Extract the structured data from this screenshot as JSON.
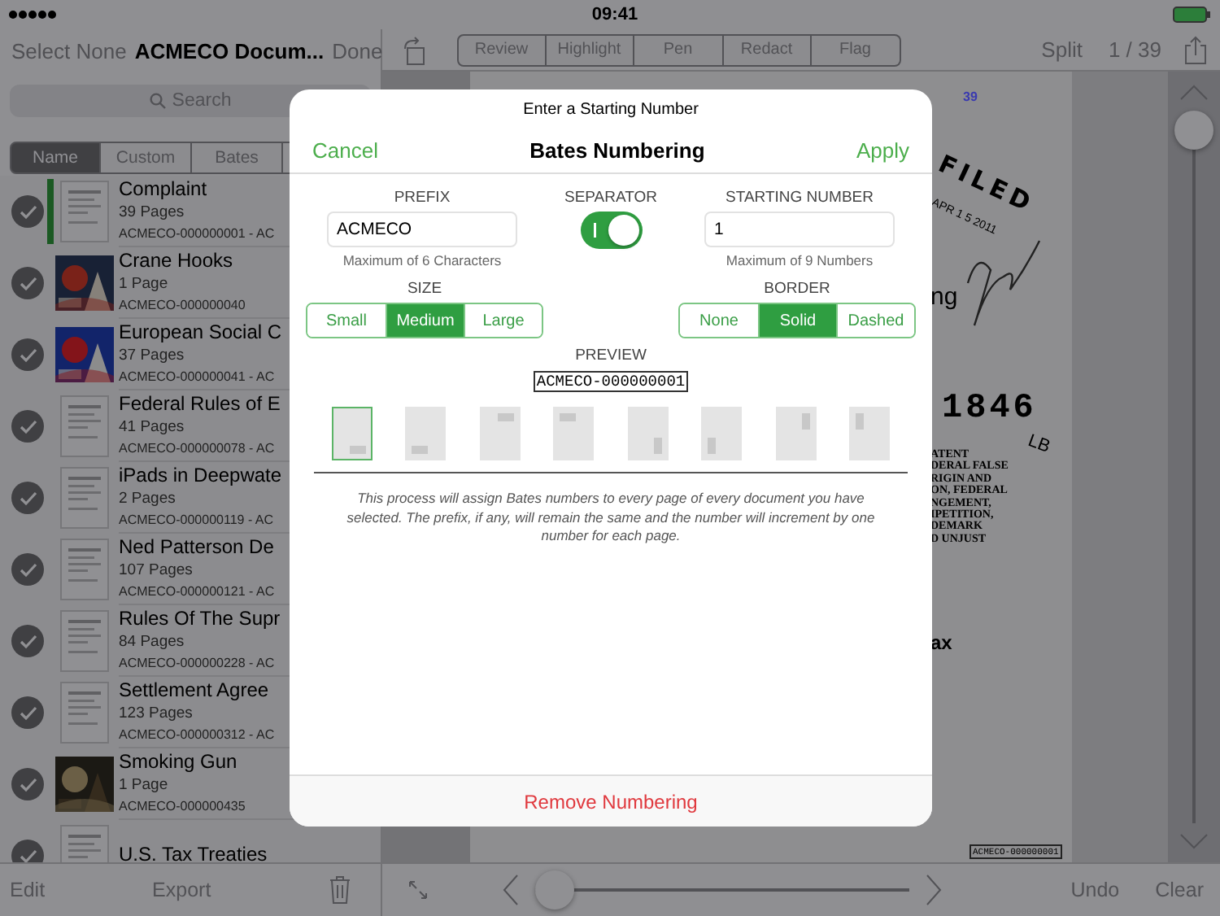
{
  "status_bar": {
    "time": "09:41"
  },
  "library": {
    "select_none": "Select None",
    "title": "ACMECO Docum...",
    "done": "Done",
    "search": {
      "placeholder": "Search"
    },
    "sort_tabs": [
      {
        "label": "Name",
        "selected": true
      },
      {
        "label": "Custom",
        "selected": false
      },
      {
        "label": "Bates",
        "selected": false
      }
    ],
    "documents": [
      {
        "title": "Complaint",
        "pages": "39 Pages",
        "bates": "ACMECO-000000001 - AC",
        "checked": true,
        "color": "#1b5923",
        "kind": "page"
      },
      {
        "title": "Crane Hooks",
        "pages": "1 Page",
        "bates": "ACMECO-000000040",
        "checked": true,
        "kind": "picture"
      },
      {
        "title": "European Social C",
        "pages": "37 Pages",
        "bates": "ACMECO-000000041 - AC",
        "checked": true,
        "kind": "picture"
      },
      {
        "title": "Federal Rules of E",
        "pages": "41 Pages",
        "bates": "ACMECO-000000078 - AC",
        "checked": true,
        "kind": "page"
      },
      {
        "title": "iPads in Deepwate",
        "pages": "2 Pages",
        "bates": "ACMECO-000000119 - AC",
        "checked": true,
        "kind": "page"
      },
      {
        "title": "Ned Patterson De",
        "pages": "107 Pages",
        "bates": "ACMECO-000000121 - AC",
        "checked": true,
        "kind": "page"
      },
      {
        "title": "Rules Of The Supr",
        "pages": "84 Pages",
        "bates": "ACMECO-000000228 - AC",
        "checked": true,
        "kind": "page"
      },
      {
        "title": "Settlement Agree",
        "pages": "123 Pages",
        "bates": "ACMECO-000000312 - AC",
        "checked": true,
        "kind": "page"
      },
      {
        "title": "Smoking Gun",
        "pages": "1 Page",
        "bates": "ACMECO-000000435",
        "checked": true,
        "kind": "picture"
      },
      {
        "title": "U.S. Tax Treaties",
        "checked": true,
        "kind": "page"
      }
    ],
    "edit": "Edit",
    "export": "Export"
  },
  "viewer": {
    "tools": [
      "Review",
      "Highlight",
      "Pen",
      "Redact",
      "Flag"
    ],
    "split": "Split",
    "page": "1 / 39",
    "document": {
      "stamp_count": "39",
      "filed": "FILED",
      "filed_date": "APR 1 5 2011",
      "word_end": "ng",
      "case_number": "1846",
      "initials": "LB",
      "caption": [
        "ATENT",
        "DERAL FALSE",
        "RIGIN AND",
        "ON, FEDERAL",
        "NGEMENT,",
        "IPETITION,",
        "DEMARK",
        "D UNJUST"
      ],
      "fragment": "ax",
      "bates_stamp": "ACMECO-000000001"
    },
    "zoom_slider": {
      "level": 0
    },
    "page_slider": {
      "level": 0
    },
    "undo": "Undo",
    "clear": "Clear"
  },
  "dialog": {
    "prompt": "Enter a Starting Number",
    "cancel": "Cancel",
    "title": "Bates Numbering",
    "apply": "Apply",
    "prefix": {
      "label": "PREFIX",
      "value": "ACMECO",
      "hint": "Maximum of 6 Characters"
    },
    "separator": {
      "label": "SEPARATOR",
      "on": true
    },
    "starting_number": {
      "label": "STARTING NUMBER",
      "value": "1",
      "hint": "Maximum of 9 Numbers"
    },
    "size": {
      "label": "SIZE",
      "options": [
        {
          "label": "Small",
          "selected": false
        },
        {
          "label": "Medium",
          "selected": true
        },
        {
          "label": "Large",
          "selected": false
        }
      ]
    },
    "border": {
      "label": "BORDER",
      "options": [
        {
          "label": "None",
          "selected": false
        },
        {
          "label": "Solid",
          "selected": true
        },
        {
          "label": "Dashed",
          "selected": false
        }
      ]
    },
    "preview": {
      "label": "PREVIEW",
      "value": "ACMECO-000000001"
    },
    "positions": [
      {
        "kind": "bottom-right-h",
        "selected": true
      },
      {
        "kind": "bottom-left-h",
        "selected": false
      },
      {
        "kind": "top-right-h",
        "selected": false
      },
      {
        "kind": "top-left-h",
        "selected": false
      },
      {
        "kind": "bottom-right-v",
        "selected": false
      },
      {
        "kind": "bottom-left-v",
        "selected": false
      },
      {
        "kind": "top-right-v",
        "selected": false
      },
      {
        "kind": "top-left-v",
        "selected": false
      }
    ],
    "note": "This process will assign Bates numbers to every page of every document you have selected. The prefix, if any, will remain the same and the number will increment by one number for each page.",
    "remove": "Remove Numbering"
  }
}
